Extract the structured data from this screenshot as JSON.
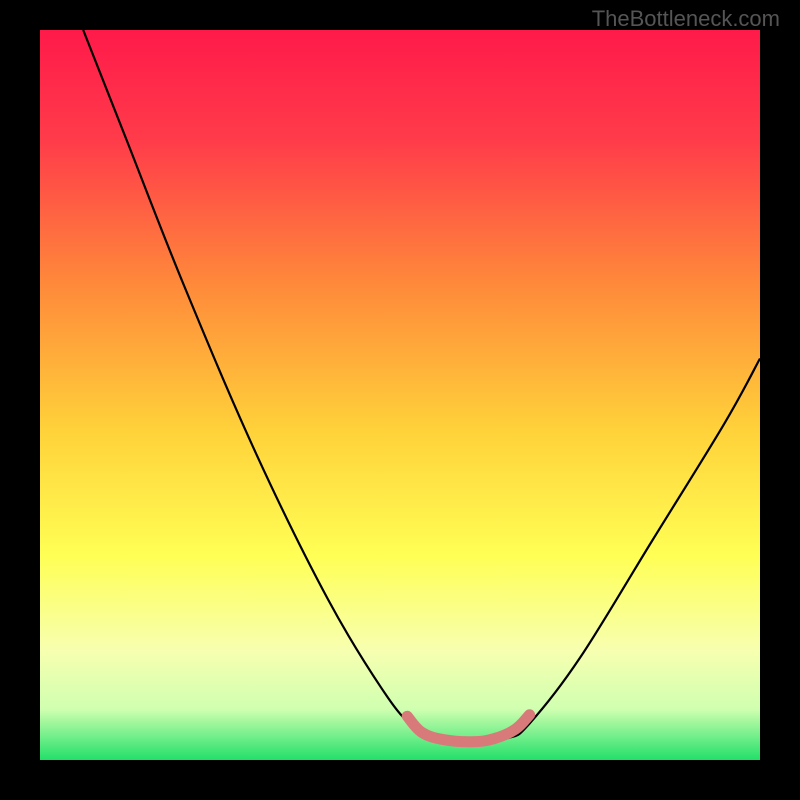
{
  "watermark": "TheBottleneck.com",
  "chart_data": {
    "type": "line",
    "title": "",
    "xlabel": "",
    "ylabel": "",
    "xlim": [
      0,
      100
    ],
    "ylim": [
      0,
      100
    ],
    "grid": false,
    "legend": false,
    "gradient_stops": [
      {
        "offset": 0,
        "color": "#ff1a4a"
      },
      {
        "offset": 0.15,
        "color": "#ff3b4a"
      },
      {
        "offset": 0.35,
        "color": "#ff8a3a"
      },
      {
        "offset": 0.55,
        "color": "#ffd23a"
      },
      {
        "offset": 0.72,
        "color": "#ffff55"
      },
      {
        "offset": 0.85,
        "color": "#f7ffb0"
      },
      {
        "offset": 0.93,
        "color": "#d0ffb0"
      },
      {
        "offset": 1.0,
        "color": "#22e06a"
      }
    ],
    "series": [
      {
        "name": "bottleneck-curve",
        "color": "#000000",
        "points": [
          {
            "x": 6,
            "y": 100
          },
          {
            "x": 12,
            "y": 85
          },
          {
            "x": 20,
            "y": 65
          },
          {
            "x": 30,
            "y": 42
          },
          {
            "x": 40,
            "y": 22
          },
          {
            "x": 48,
            "y": 9
          },
          {
            "x": 52,
            "y": 4.5
          },
          {
            "x": 55,
            "y": 3
          },
          {
            "x": 60,
            "y": 2.5
          },
          {
            "x": 65,
            "y": 3
          },
          {
            "x": 68,
            "y": 5
          },
          {
            "x": 75,
            "y": 14
          },
          {
            "x": 85,
            "y": 30
          },
          {
            "x": 95,
            "y": 46
          },
          {
            "x": 100,
            "y": 55
          }
        ]
      },
      {
        "name": "optimal-zone-marker",
        "color": "#d97a7a",
        "points": [
          {
            "x": 51,
            "y": 6
          },
          {
            "x": 53,
            "y": 3.8
          },
          {
            "x": 56,
            "y": 2.8
          },
          {
            "x": 60,
            "y": 2.5
          },
          {
            "x": 63,
            "y": 2.9
          },
          {
            "x": 66,
            "y": 4.2
          },
          {
            "x": 68,
            "y": 6.2
          }
        ]
      }
    ]
  }
}
